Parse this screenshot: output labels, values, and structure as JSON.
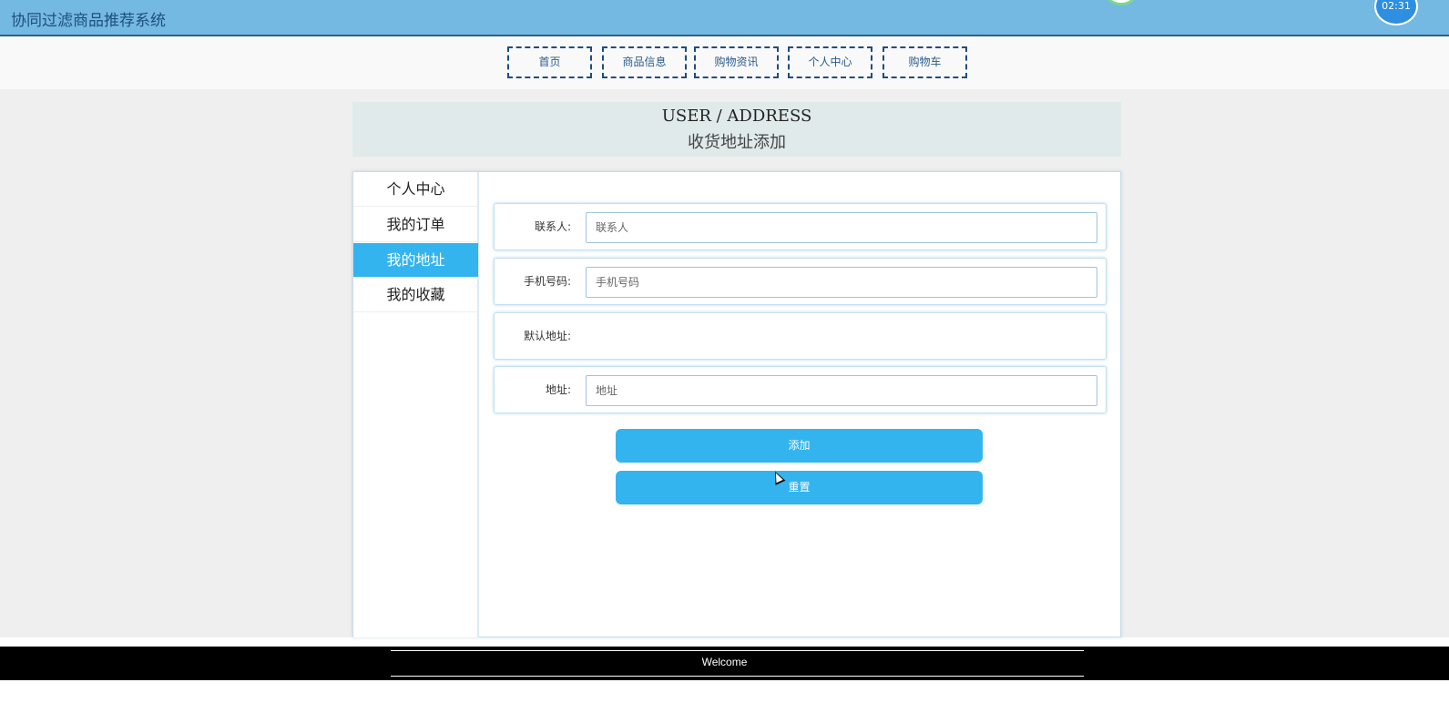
{
  "header": {
    "title": "协同过滤商品推荐系统",
    "clock": "02:31"
  },
  "nav": {
    "items": [
      {
        "label": "首页"
      },
      {
        "label": "商品信息"
      },
      {
        "label": "购物资讯"
      },
      {
        "label": "个人中心"
      },
      {
        "label": "购物车"
      }
    ]
  },
  "page_heading": {
    "en": "USER / ADDRESS",
    "cn": "收货地址添加"
  },
  "sidebar": {
    "items": [
      {
        "label": "个人中心",
        "active": false
      },
      {
        "label": "我的订单",
        "active": false
      },
      {
        "label": "我的地址",
        "active": true
      },
      {
        "label": "我的收藏",
        "active": false
      }
    ]
  },
  "form": {
    "contact": {
      "label": "联系人:",
      "placeholder": "联系人",
      "value": ""
    },
    "phone": {
      "label": "手机号码:",
      "placeholder": "手机号码",
      "value": ""
    },
    "default_address": {
      "label": "默认地址:"
    },
    "address": {
      "label": "地址:",
      "placeholder": "地址",
      "value": ""
    }
  },
  "actions": {
    "add_label": "添加",
    "reset_label": "重置"
  },
  "footer": {
    "text": "Welcome"
  },
  "colors": {
    "header_bg": "#74b9e2",
    "accent": "#33b4ef",
    "nav_border": "#1e4d80",
    "footer_bg": "#000000"
  }
}
